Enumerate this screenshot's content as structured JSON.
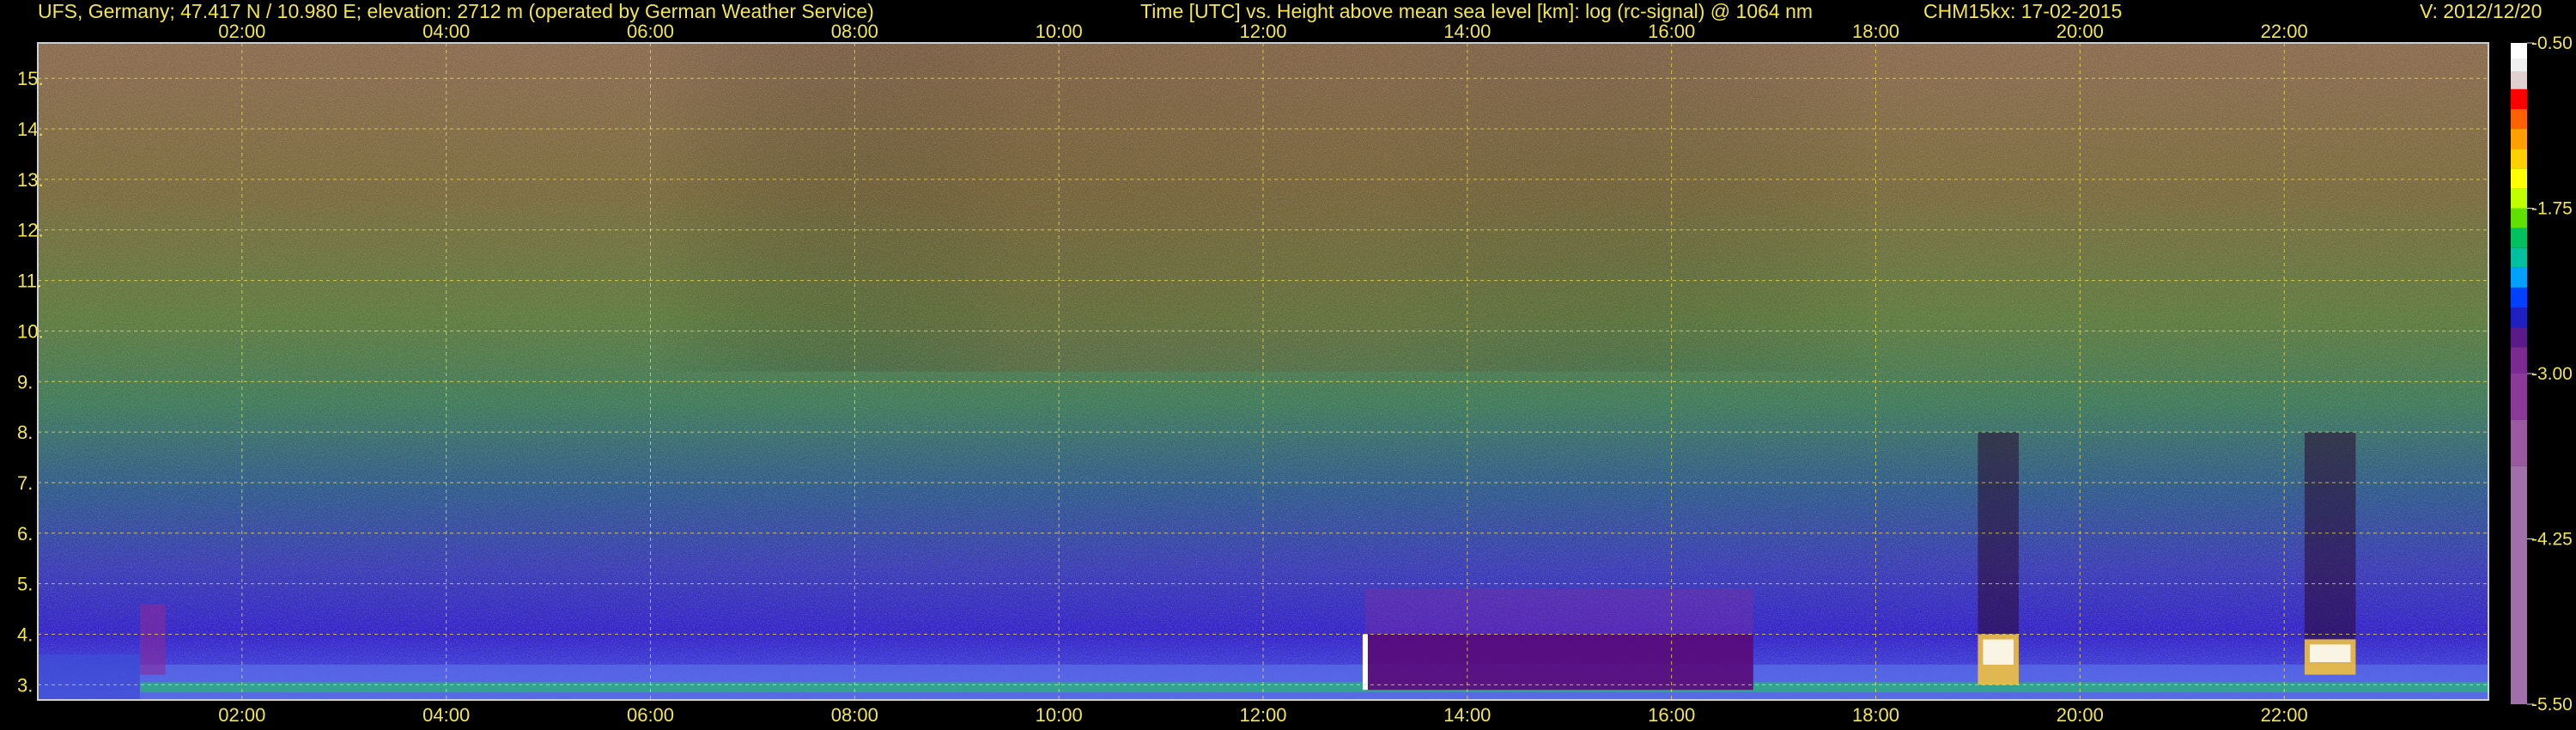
{
  "header": {
    "site": "UFS, Germany; 47.417 N / 10.980 E; elevation: 2712 m  (operated by German Weather Service)",
    "plot_title": "Time [UTC] vs. Height above mean sea level [km]: log (rc-signal) @ 1064 nm",
    "instrument_date": "CHM15kx: 17-02-2015",
    "version": "V: 2012/12/20"
  },
  "colors": {
    "background": "#000000",
    "text": "#f2e64a",
    "grid": "#f2e64a",
    "boundary_layer": "#3a1fc8",
    "aerosol_haze": "#8a2a9a",
    "noise_high": "#c8b088"
  },
  "chart_data": {
    "type": "heatmap",
    "title": "Time [UTC] vs. Height above mean sea level [km]: log (rc-signal) @ 1064 nm",
    "x": {
      "label": "Time [UTC]",
      "range_hours": [
        0.0,
        24.0
      ],
      "tick_hours": [
        2,
        4,
        6,
        8,
        10,
        12,
        14,
        16,
        18,
        20,
        22
      ],
      "tick_labels": [
        "02:00",
        "04:00",
        "06:00",
        "08:00",
        "10:00",
        "12:00",
        "14:00",
        "16:00",
        "18:00",
        "20:00",
        "22:00"
      ]
    },
    "y": {
      "label": "Height above mean sea level [km]",
      "range_km": [
        2.7,
        15.7
      ],
      "ticks": [
        3,
        4,
        5,
        6,
        7,
        8,
        9,
        10,
        11,
        12,
        13,
        14,
        15
      ],
      "tick_labels": [
        "3.",
        "4.",
        "5.",
        "6.",
        "7.",
        "8.",
        "9.",
        "10.",
        "11.",
        "12.",
        "13.",
        "14.",
        "15."
      ]
    },
    "colorbar": {
      "label": "log (rc-signal)",
      "range": [
        -5.5,
        -0.5
      ],
      "tick_values": [
        -0.5,
        -1.75,
        -3.0,
        -4.25,
        -5.5
      ],
      "tick_labels": [
        "-0.50",
        "-1.75",
        "-3.00",
        "-4.25",
        "-5.50"
      ]
    },
    "grid": true,
    "features": [
      {
        "name": "boundary layer",
        "start_hour": 1.0,
        "end_hour": 24.0,
        "top_km": 3.4
      },
      {
        "name": "aerosol layer",
        "start_hour": 13.0,
        "end_hour": 16.8,
        "top_km": 4.0
      },
      {
        "name": "cloud",
        "start_hour": 19.0,
        "end_hour": 19.4,
        "base_km": 3.0,
        "top_km": 4.0
      },
      {
        "name": "cloud",
        "start_hour": 22.2,
        "end_hour": 22.7,
        "base_km": 3.2,
        "top_km": 3.9
      }
    ]
  }
}
